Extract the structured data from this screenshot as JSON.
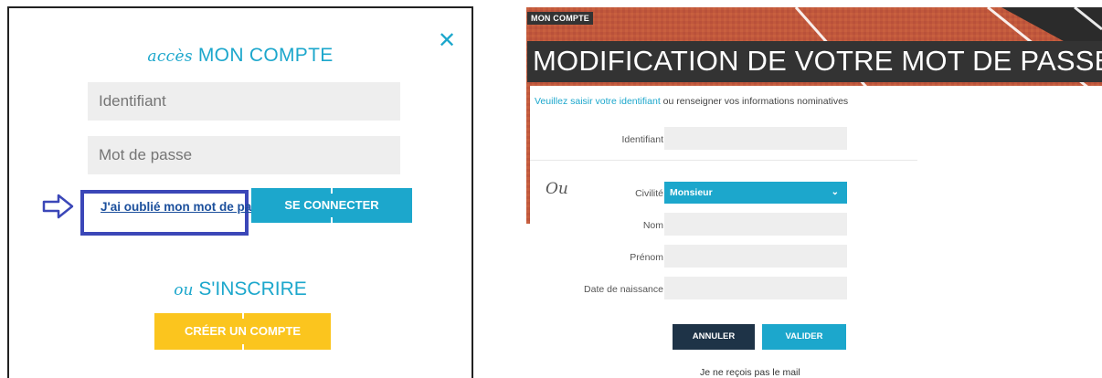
{
  "login": {
    "title_script": "accès",
    "title_main": "MON COMPTE",
    "close_glyph": "✕",
    "identifier_placeholder": "Identifiant",
    "password_placeholder": "Mot de passe",
    "forgot_link": "J'ai oublié mon mot de passe",
    "connect_button": "SE CONNECTER",
    "register_script": "ou",
    "register_main": "S'INSCRIRE",
    "create_button": "CRÉER UN COMPTE"
  },
  "reset": {
    "breadcrumb": "MON COMPTE",
    "title": "MODIFICATION DE VOTRE MOT DE PASSE",
    "intro_link": "Veuillez saisir votre identifiant",
    "intro_rest": " ou renseigner vos informations nominatives",
    "identifier_label": "Identifiant",
    "ou_label": "Ou",
    "civility_label": "Civilité",
    "civility_value": "Monsieur",
    "name_label": "Nom",
    "firstname_label": "Prénom",
    "birthdate_label": "Date de naissance",
    "cancel_button": "ANNULER",
    "validate_button": "VALIDER",
    "no_mail_link": "Je ne reçois pas le mail"
  },
  "colors": {
    "accent_blue": "#1ca7cc",
    "create_yellow": "#fbc51e",
    "highlight_box": "#3b47b8",
    "hero_terracotta": "#c1583c",
    "cancel_navy": "#1e3347"
  },
  "icons": {
    "close": "close-icon",
    "pointer_arrow": "arrow-right-icon",
    "select_chevron": "chevron-down-icon"
  }
}
